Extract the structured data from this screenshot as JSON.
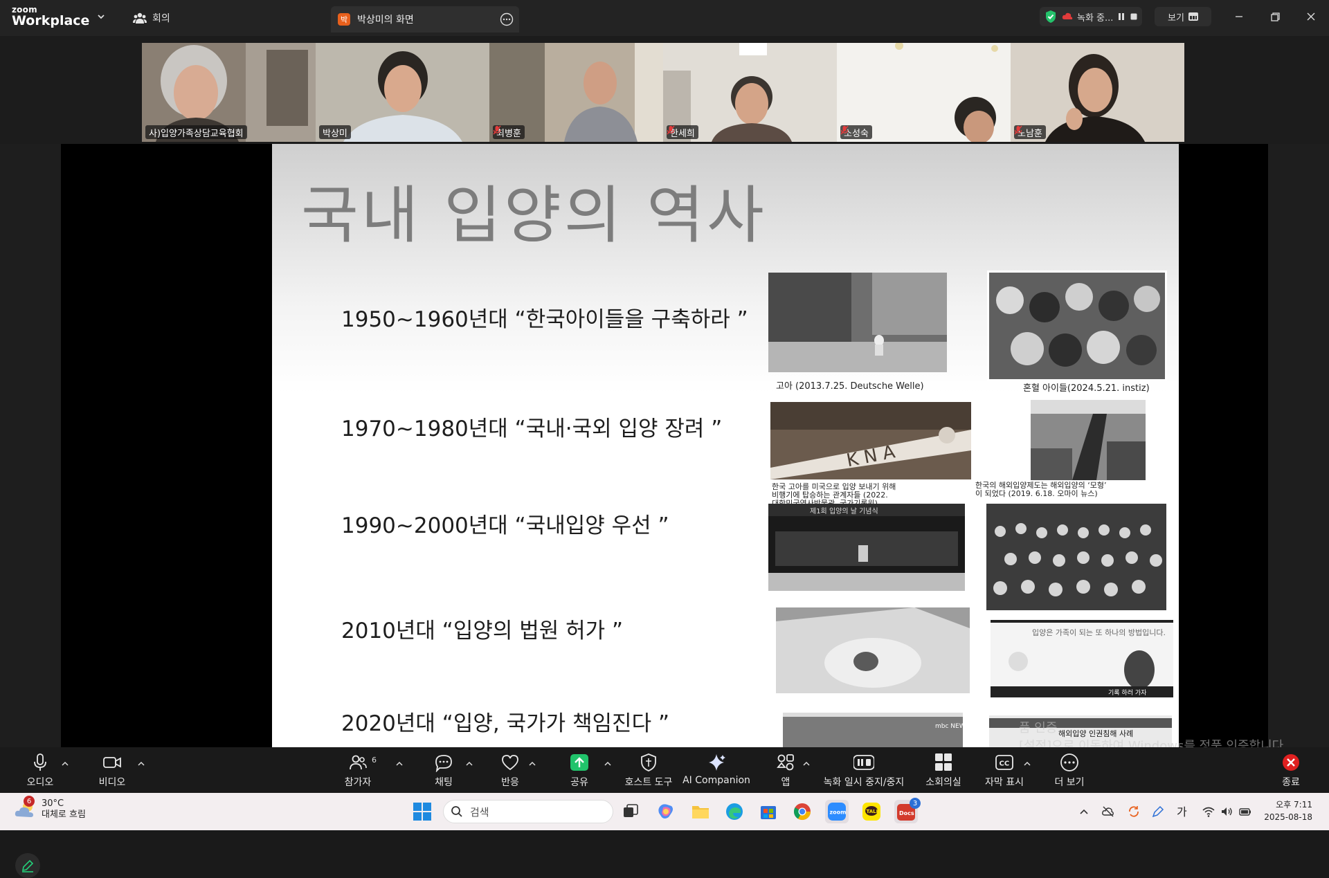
{
  "titlebar": {
    "logo_small": "zoom",
    "logo_big": "Workplace",
    "meeting_tab": "회의",
    "share_tab_badge": "박",
    "share_tab_title": "박상미의 화면",
    "recording_status": "녹화 중...",
    "view_label": "보기"
  },
  "participants": [
    {
      "name": "사)입양가족상담교육협회",
      "muted": false,
      "active": false
    },
    {
      "name": "박상미",
      "muted": false,
      "active": true
    },
    {
      "name": "최병훈",
      "muted": true,
      "active": false
    },
    {
      "name": "한세희",
      "muted": true,
      "active": false
    },
    {
      "name": "소성숙",
      "muted": true,
      "active": false
    },
    {
      "name": "노남훈",
      "muted": true,
      "active": false
    }
  ],
  "slide": {
    "title": "국내 입양의 역사",
    "eras": [
      "1950~1960년대 “한국아이들을 구축하라 ”",
      "1970~1980년대 “국내·국외 입양 장려 ”",
      "1990~2000년대 “국내입양 우선 ”",
      "2010년대 “입양의 법원  허가 ”",
      "2020년대 “입양, 국가가 책임진다 ”"
    ],
    "captions": {
      "c1": "고아 (2013.7.25. Deutsche Welle)",
      "c2": "혼혈 아이들(2024.5.21. instiz)",
      "c3_l1": "한국 고아를 미국으로 입양 보내기 위해",
      "c3_l2": "비행기에 탑승하는 관계자들 (2022.",
      "c3_l3": "대한민국역사박물관, 국가기록원)",
      "c4_l1": "한국의 해외입양제도는 해외입양의 ‘모형’",
      "c4_l2": "이 되었다 (2019. 6.18. 오마이 뉴스)",
      "plane_text": "K N A",
      "banner_text": "제1회 입양의 날 기념식",
      "sign_text": "입양은 가족이 되는 또 하나의 방법입니다.",
      "sign_sub": "기록 하러 가자",
      "news_logo": "mbc NEWS",
      "news_banner": "해외입양 인권침해 사례"
    }
  },
  "watermark": {
    "line1": "품 인증",
    "line2": "[설정]으로 이동하여 Windows를 정품 인증합니다."
  },
  "toolbar": {
    "audio": "오디오",
    "video": "비디오",
    "participants": "참가자",
    "participants_count": "6",
    "chat": "채팅",
    "reactions": "반응",
    "share": "공유",
    "host_tools": "호스트 도구",
    "ai_companion": "AI Companion",
    "apps": "앱",
    "record": "녹화 일시 중지/중지",
    "breakout": "소회의실",
    "captions": "자막 표시",
    "more": "더 보기",
    "end": "종료"
  },
  "taskbar": {
    "weather_badge": "6",
    "temp": "30°C",
    "condition": "대체로 흐림",
    "search_placeholder": "검색",
    "docs_badge": "3",
    "ime": "가",
    "time": "오후 7:11",
    "date": "2025-08-18"
  },
  "colors": {
    "active_speaker": "#24d07a",
    "share_green": "#21c36b",
    "end_red": "#e02020",
    "rec_red": "#e23b3b"
  }
}
